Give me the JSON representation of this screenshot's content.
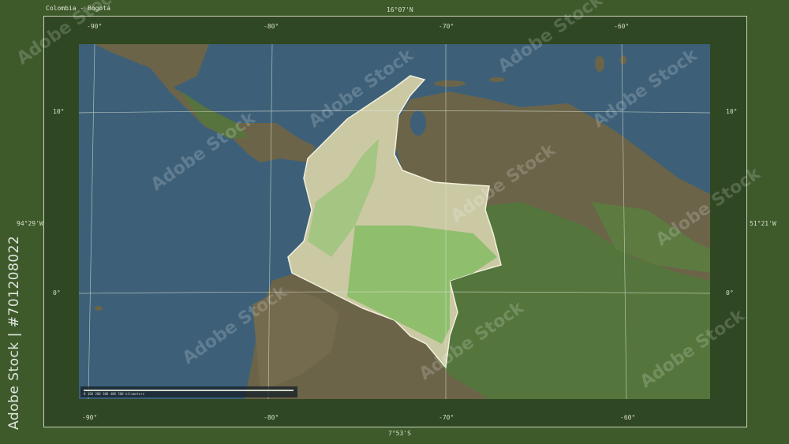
{
  "title": "Colombia - Bogotá",
  "coords": {
    "top": "16°07'N",
    "bottom": "7°53'S",
    "left": "94°29'W",
    "right": "51°21'W"
  },
  "lon_labels": [
    "-90°",
    "-80°",
    "-70°",
    "-60°"
  ],
  "lat_labels": [
    "10°",
    "0°"
  ],
  "watermark": "Adobe Stock",
  "side_id": "Adobe Stock | #701208022",
  "scale_text": "0   100   200   300   400   500 kilometers",
  "colors": {
    "frame": "#3e5a2b",
    "ocean": "#3d6078",
    "land": "#6b6448",
    "highlight": "#cbc9a4",
    "forest": "#4f7a3a"
  }
}
